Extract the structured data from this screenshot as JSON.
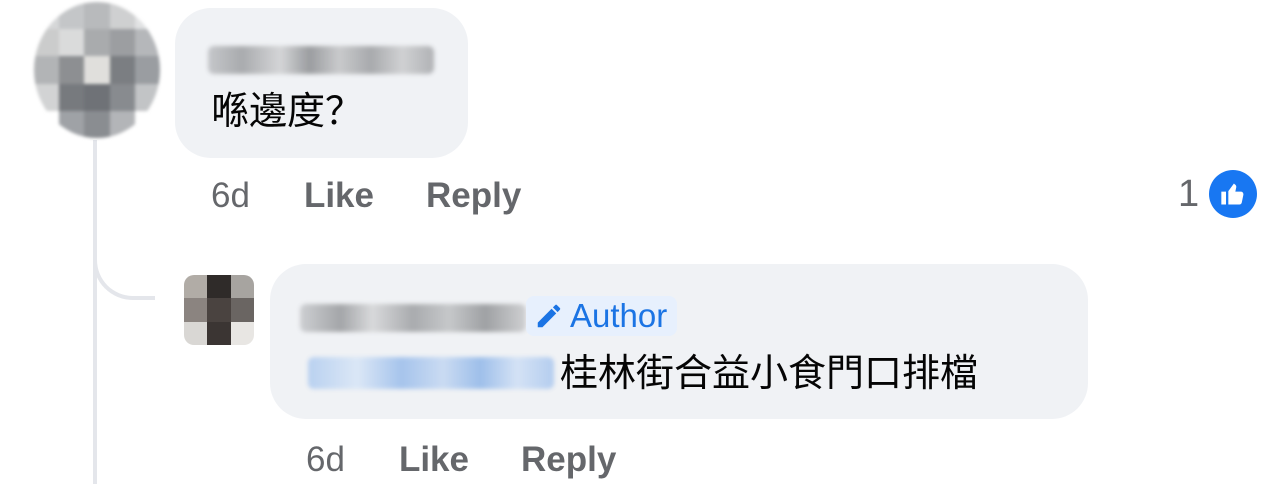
{
  "comments": [
    {
      "author_name": "",
      "text": "喺邊度？",
      "time": "6d",
      "like_label": "Like",
      "reply_label": "Reply",
      "reaction_count": "1",
      "reaction_icon": "like-thumbs-up-icon"
    },
    {
      "author_name": "",
      "author_badge": "Author",
      "badge_icon": "pencil-icon",
      "mention": "",
      "text": "桂林街合益小食門口排檔",
      "time": "6d",
      "like_label": "Like",
      "reply_label": "Reply"
    }
  ],
  "colors": {
    "bubble": "#f0f2f5",
    "action_text": "#65676b",
    "badge_text": "#1b74e4",
    "badge_bg": "#e7f0fd",
    "like_reaction": "#1877f2",
    "thread_line": "#e4e6eb"
  }
}
